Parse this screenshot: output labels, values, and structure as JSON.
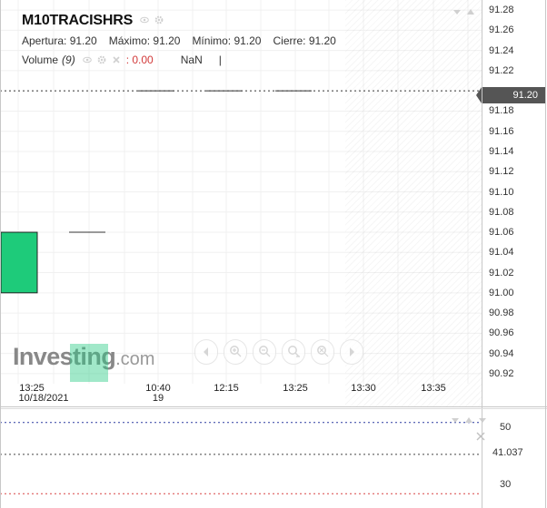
{
  "header": {
    "symbol": "M10TRACISHRS",
    "ohlc": {
      "open": "Apertura: 91.20",
      "high": "Máximo: 91.20",
      "low": "Mínimo: 91.20",
      "close": "Cierre: 91.20"
    },
    "volume": {
      "label": "Volume",
      "count": "(9)",
      "value": ": 0.00",
      "nan": "NaN",
      "cursor": "|"
    }
  },
  "price_tag": "91.20",
  "y_ticks": [
    "91.28",
    "91.26",
    "91.24",
    "91.22",
    "91.18",
    "91.16",
    "91.14",
    "91.12",
    "91.10",
    "91.08",
    "91.06",
    "91.04",
    "91.02",
    "91.00",
    "90.98",
    "90.96",
    "90.94",
    "90.92"
  ],
  "x_ticks": [
    "13:25",
    "10:40",
    "12:15",
    "13:25",
    "13:30",
    "13:35"
  ],
  "x_dates": [
    "10/18/2021",
    "19"
  ],
  "logo": {
    "word": "Investing",
    "suffix": ".com"
  },
  "sub_pane": {
    "ticks": [
      "50",
      "41.037",
      "30"
    ]
  },
  "icons": {
    "eye": "eye-icon",
    "gear": "gear-icon",
    "close": "close-icon",
    "chevron": "chevron-down-icon",
    "up": "arrow-up-icon",
    "close_pane": "close-pane-icon"
  },
  "colors": {
    "candle_up": "#1ecb7a",
    "price_tag_bg": "#555555",
    "volume_value": "#d23a3a",
    "sub_line_blue": "#2b3aa0",
    "sub_line_red": "#d84545"
  },
  "chart_data": {
    "type": "candlestick",
    "y_range": [
      90.91,
      91.29
    ],
    "current_price": 91.2,
    "candles": [
      {
        "open": 91.0,
        "close": 91.06,
        "high": 91.06,
        "low": 91.0,
        "slot": 0
      },
      {
        "open": 91.06,
        "close": 91.06,
        "high": 91.06,
        "low": 91.06,
        "slot": 1
      },
      {
        "open": 91.2,
        "close": 91.2,
        "high": 91.2,
        "low": 91.2,
        "slot": 2
      },
      {
        "open": 91.2,
        "close": 91.2,
        "high": 91.2,
        "low": 91.2,
        "slot": 3
      },
      {
        "open": 91.2,
        "close": 91.2,
        "high": 91.2,
        "low": 91.2,
        "slot": 4
      }
    ],
    "oscillator": {
      "upper": 50,
      "value": 41.037,
      "lower": 30
    }
  }
}
